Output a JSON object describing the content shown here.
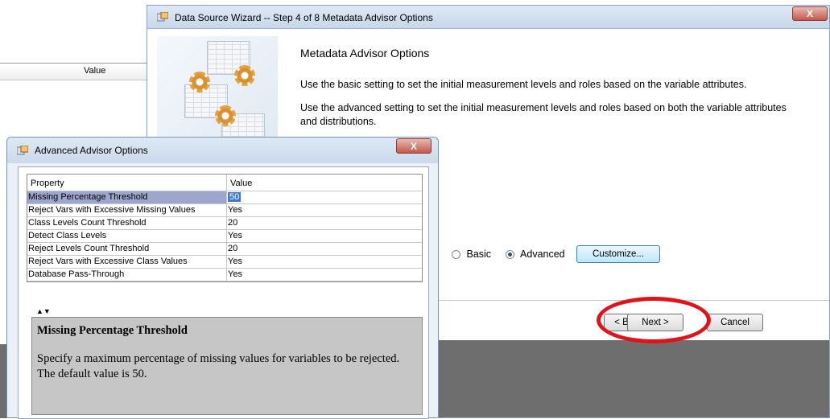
{
  "background_panel": {
    "column_header": "Value"
  },
  "wizard": {
    "title": "Data Source Wizard  -- Step 4 of 8  Metadata Advisor Options",
    "close_label": "X",
    "heading": "Metadata Advisor Options",
    "basic_description": "Use the basic setting to set the initial measurement levels and roles based on the variable attributes.",
    "advanced_description": "Use the advanced setting to set the initial measurement levels and roles based on both the variable attributes and distributions.",
    "options": {
      "basic_label": "Basic",
      "advanced_label": "Advanced",
      "selected": "Advanced",
      "customize_label": "Customize..."
    },
    "footer": {
      "back_label": "< Back",
      "next_label": "Next >",
      "cancel_label": "Cancel"
    },
    "annotation_color": "#e0131a"
  },
  "advanced_dialog": {
    "title": "Advanced Advisor Options",
    "close_label": "X",
    "table": {
      "headers": [
        "Property",
        "Value"
      ],
      "rows": [
        {
          "property": "Missing Percentage Threshold",
          "value": "50",
          "selected": true
        },
        {
          "property": "Reject Vars with Excessive Missing Values",
          "value": "Yes"
        },
        {
          "property": "Class Levels Count Threshold",
          "value": "20"
        },
        {
          "property": "Detect Class Levels",
          "value": "Yes"
        },
        {
          "property": "Reject Levels Count Threshold",
          "value": "20"
        },
        {
          "property": "Reject Vars with Excessive Class Values",
          "value": "Yes"
        },
        {
          "property": "Database Pass-Through",
          "value": "Yes"
        }
      ]
    },
    "splitter_glyph": "▲▼",
    "description": {
      "title": "Missing Percentage Threshold",
      "text": "Specify a maximum percentage of missing values for variables to be rejected. The default value is 50."
    }
  }
}
